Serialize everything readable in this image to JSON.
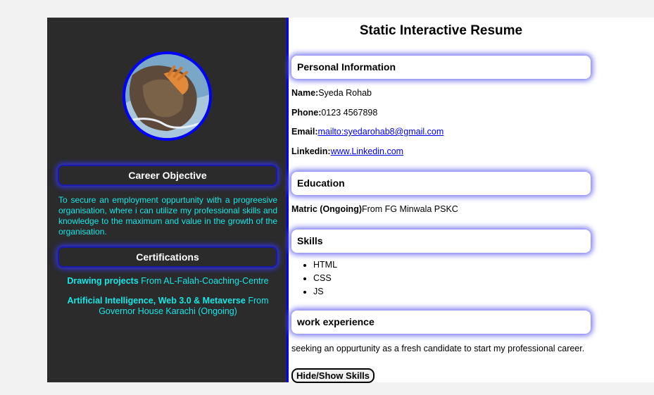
{
  "page_title": "Static Interactive Resume",
  "sidebar": {
    "avatar": "profile-photo",
    "objective_heading": "Career Objective",
    "objective_text": "To secure an employment oppurtunity with a progreesive organisation, where i can utilize my professional skills and knowledge to the maximum and value in the growth of the organisation.",
    "certifications_heading": "Certifications",
    "certifications": [
      {
        "title": "Drawing projects",
        "detail": "From AL-Falah-Coaching-Centre"
      },
      {
        "title": "Artificial Intelligence, Web 3.0 & Metaverse",
        "detail": "From Governor House Karachi (Ongoing)"
      }
    ]
  },
  "personal": {
    "heading": "Personal Information",
    "name_label": "Name:",
    "name": "Syeda Rohab",
    "phone_label": "Phone:",
    "phone": "0123 4567898",
    "email_label": "Email:",
    "email": "mailto:syedarohab8@gmail.com",
    "linkedin_label": "Linkedin:",
    "linkedin": "www.Linkedin.com"
  },
  "education": {
    "heading": "Education",
    "degree": "Matric (Ongoing)",
    "institute": "From FG Minwala PSKC"
  },
  "skills": {
    "heading": "Skills",
    "items": [
      "HTML",
      "CSS",
      "JS"
    ]
  },
  "experience": {
    "heading": "work experience",
    "text": "seeking an oppurtunity as a fresh candidate to start my professional career."
  },
  "toggle_button": "Hide/Show Skills",
  "colors": {
    "sidebar_bg": "#2b2b2b",
    "accent_blue": "#0000ff",
    "cyan_text": "#19e6e6",
    "link": "#0000ee"
  }
}
